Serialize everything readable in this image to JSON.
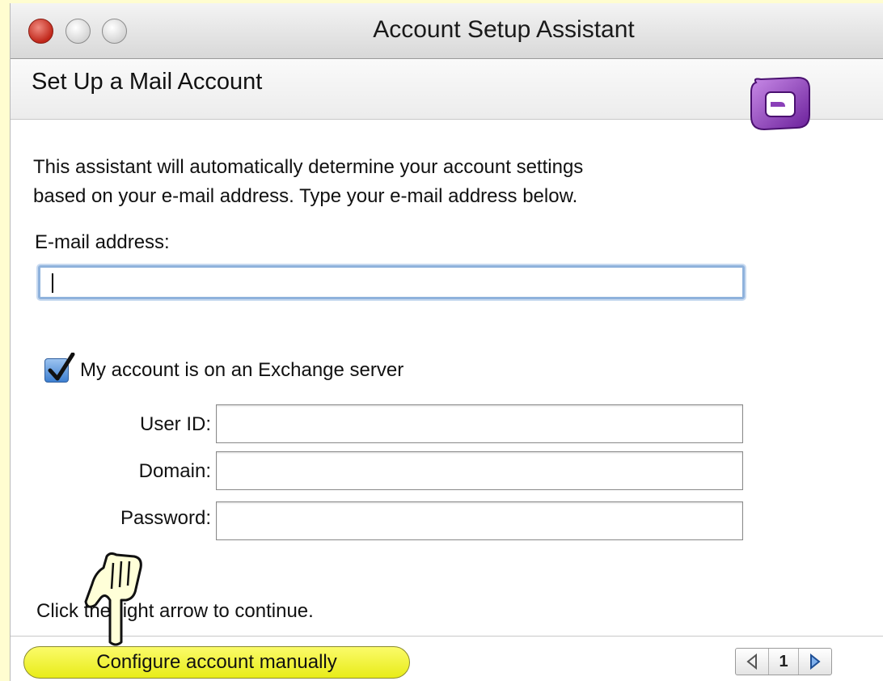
{
  "window": {
    "title": "Account Setup Assistant",
    "buttons": {
      "close": "close-icon",
      "minimize": "minimize-icon",
      "zoom": "zoom-icon"
    }
  },
  "header": {
    "title": "Set Up a Mail Account",
    "icon": "entourage-icon"
  },
  "intro": {
    "text": "This assistant will automatically determine your account settings\nbased on your e-mail address. Type your e-mail address below."
  },
  "email": {
    "label": "E-mail address:",
    "value": ""
  },
  "exchange": {
    "checkbox_label": "My account is on an Exchange server",
    "checked": true
  },
  "fields": {
    "user_id": {
      "label": "User ID:",
      "value": ""
    },
    "domain": {
      "label": "Domain:",
      "value": ""
    },
    "password": {
      "label": "Password:",
      "value": ""
    }
  },
  "footer": {
    "continue_text": "Click the right arrow to continue.",
    "configure_button": "Configure account manually",
    "page_number": "1"
  },
  "colors": {
    "background": "#fffdd0",
    "highlight": "#f5f52a",
    "focus_ring": "#8fb2dc",
    "checkbox": "#3d7fd0",
    "icon_purple": "#8a3fb8"
  }
}
